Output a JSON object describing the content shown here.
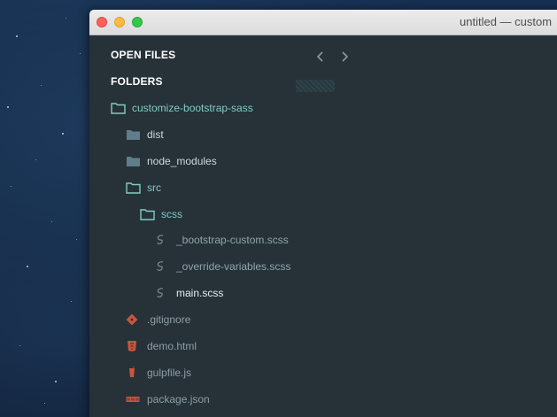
{
  "window": {
    "title": "untitled — custom"
  },
  "sidebar": {
    "open_files_label": "OPEN FILES",
    "folders_label": "FOLDERS",
    "tree": {
      "root": "customize-bootstrap-sass",
      "dist": "dist",
      "node_modules": "node_modules",
      "src": "src",
      "scss": "scss",
      "file_bootstrap_custom": "_bootstrap-custom.scss",
      "file_override_variables": "_override-variables.scss",
      "file_main": "main.scss",
      "file_gitignore": ".gitignore",
      "file_demo": "demo.html",
      "file_gulpfile": "gulpfile.js",
      "file_package": "package.json"
    }
  },
  "colors": {
    "sidebar_bg": "#263238",
    "folder_open": "#80cbc4",
    "folder_closed": "#607d8b",
    "file_text": "#90a4ae",
    "git_icon": "#e0634b",
    "html_icon": "#e44d26",
    "gulp_icon": "#d34a47",
    "json_icon": "#cc4b3c"
  },
  "icons": {
    "nav_back": "chevron-left-icon",
    "nav_forward": "chevron-right-icon",
    "folder_open": "folder-open-icon",
    "folder_closed": "folder-icon",
    "sass_file": "sass-icon",
    "git_file": "git-icon",
    "html_file": "html5-icon",
    "gulp_file": "gulp-icon",
    "json_file": "npm-icon"
  }
}
